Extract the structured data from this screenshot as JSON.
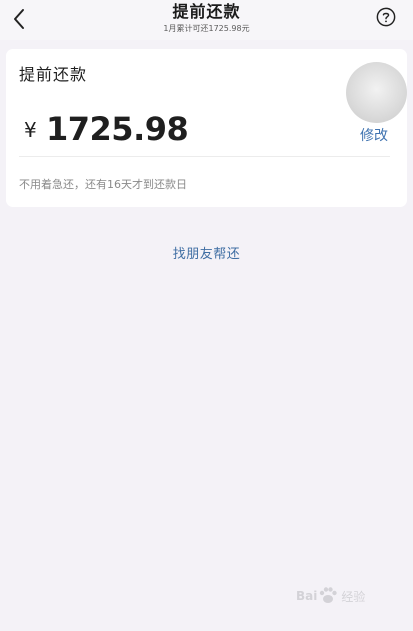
{
  "header": {
    "title": "提前还款",
    "subtitle": "1月累计可还1725.98元",
    "back_icon": "chevron-left-icon",
    "help_icon": "question-circle-icon"
  },
  "card": {
    "title": "提前还款",
    "currency": "¥",
    "amount": "1725.98",
    "modify_label": "修改",
    "hint": "不用着急还，还有16天才到还款日"
  },
  "friend_link": "找朋友帮还",
  "watermark": {
    "text": "Bai",
    "suffix": "经验"
  },
  "colors": {
    "background": "#f4f2f7",
    "link": "#3f73b0",
    "card": "#ffffff",
    "title": "#1b1b1b",
    "hint": "#8a8a8a"
  }
}
